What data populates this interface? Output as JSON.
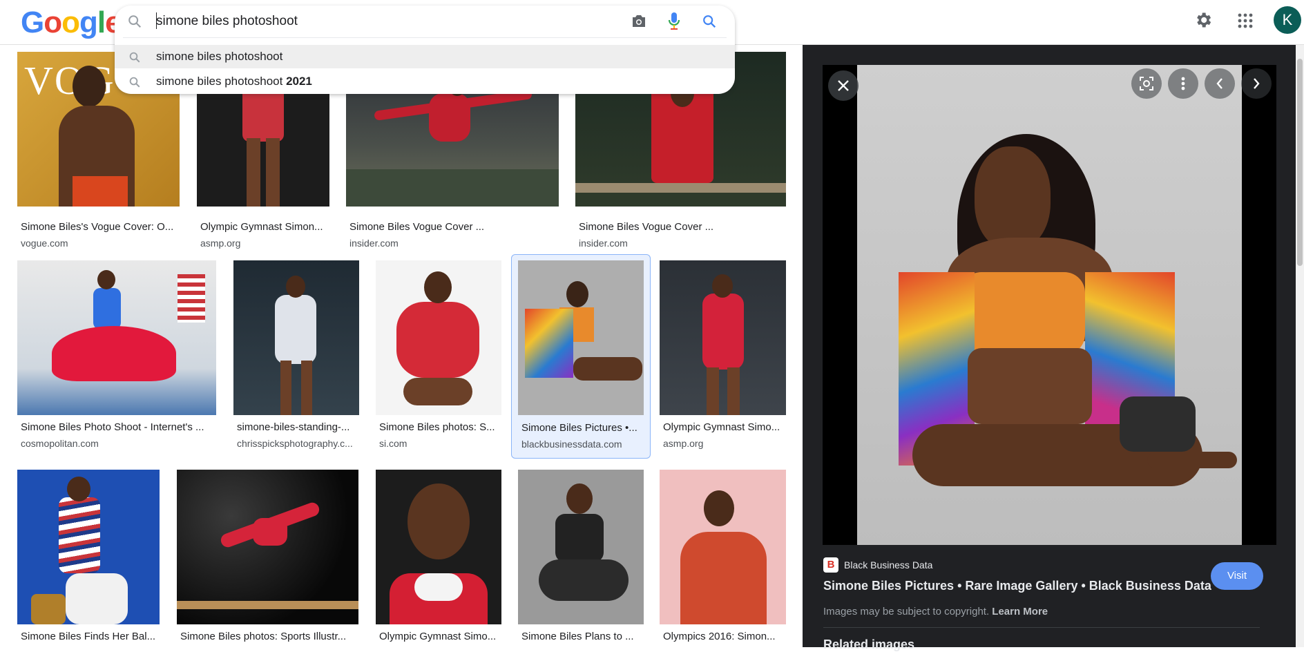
{
  "header": {
    "logo_letters": [
      "G",
      "o",
      "o",
      "g",
      "l",
      "e"
    ],
    "logo_colors": [
      "#4285F4",
      "#EA4335",
      "#FBBC05",
      "#4285F4",
      "#34A853",
      "#EA4335"
    ],
    "avatar_letter": "K"
  },
  "search": {
    "query": "simone biles photoshoot",
    "suggestions": [
      {
        "text": "simone biles photoshoot",
        "bold": ""
      },
      {
        "text": "simone biles photoshoot ",
        "bold": "2021"
      }
    ]
  },
  "results": [
    {
      "title": "Simone Biles's Vogue Cover: O...",
      "source": "vogue.com"
    },
    {
      "title": "Olympic Gymnast Simon...",
      "source": "asmp.org"
    },
    {
      "title": "Simone Biles Vogue Cover ...",
      "source": "insider.com"
    },
    {
      "title": "Simone Biles Vogue Cover ...",
      "source": "insider.com"
    },
    {
      "title": "Simone Biles Photo Shoot - Internet's ...",
      "source": "cosmopolitan.com"
    },
    {
      "title": "simone-biles-standing-...",
      "source": "chrisspicksphotography.c..."
    },
    {
      "title": "Simone Biles photos: S...",
      "source": "si.com"
    },
    {
      "title": "Simone Biles Pictures •...",
      "source": "blackbusinessdata.com"
    },
    {
      "title": "Olympic Gymnast Simo...",
      "source": "asmp.org"
    },
    {
      "title": "Simone Biles Finds Her Bal...",
      "source": ""
    },
    {
      "title": "Simone Biles photos: Sports Illustr...",
      "source": ""
    },
    {
      "title": "Olympic Gymnast Simo...",
      "source": ""
    },
    {
      "title": "Simone Biles Plans to ...",
      "source": ""
    },
    {
      "title": "Olympics 2016: Simon...",
      "source": ""
    }
  ],
  "panel": {
    "source_name": "Black Business Data",
    "favicon_letter": "B",
    "title": "Simone Biles Pictures • Rare Image Gallery • Black Business Data",
    "visit_label": "Visit",
    "copyright": "Images may be subject to copyright.",
    "learn_more": "Learn More",
    "related_heading": "Related images"
  }
}
